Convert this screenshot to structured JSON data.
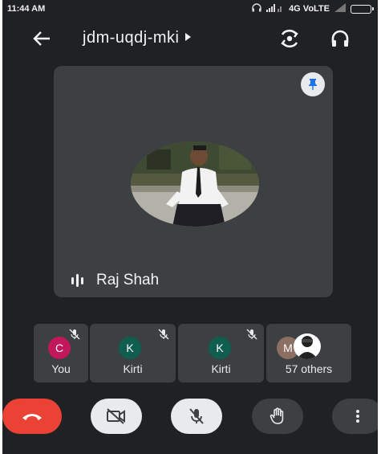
{
  "status_bar": {
    "time": "11:44 AM",
    "network": "4G VoLTE",
    "icons": [
      "headset-icon",
      "signal-icon",
      "battery-icon"
    ]
  },
  "header": {
    "meeting_code": "jdm-uqdj-mki",
    "icons": [
      "arrow-back-icon",
      "caret-right-icon",
      "switch-camera-icon",
      "headphones-icon"
    ]
  },
  "main_tile": {
    "speaker_name": "Raj Shah",
    "icons": [
      "pin-icon",
      "audio-level-icon"
    ]
  },
  "participants": [
    {
      "initial": "C",
      "label": "You",
      "avatar_color": "#c2185b",
      "muted": true
    },
    {
      "initial": "K",
      "label": "Kirti",
      "avatar_color": "#0f5e50",
      "muted": true
    },
    {
      "initial": "K",
      "label": "Kirti",
      "avatar_color": "#0f5e50",
      "muted": true
    },
    {
      "initial": "M",
      "label": "57 others",
      "avatar_color": "#8d6e63",
      "muted": false
    }
  ],
  "controls": {
    "icons": [
      "end-call-icon",
      "camera-off-icon",
      "mic-off-icon",
      "raise-hand-icon",
      "more-vert-icon"
    ],
    "end_call_color": "#ea4335"
  },
  "colors": {
    "background": "#202124",
    "tile": "#3c4043",
    "light_button": "#e8eaed"
  }
}
